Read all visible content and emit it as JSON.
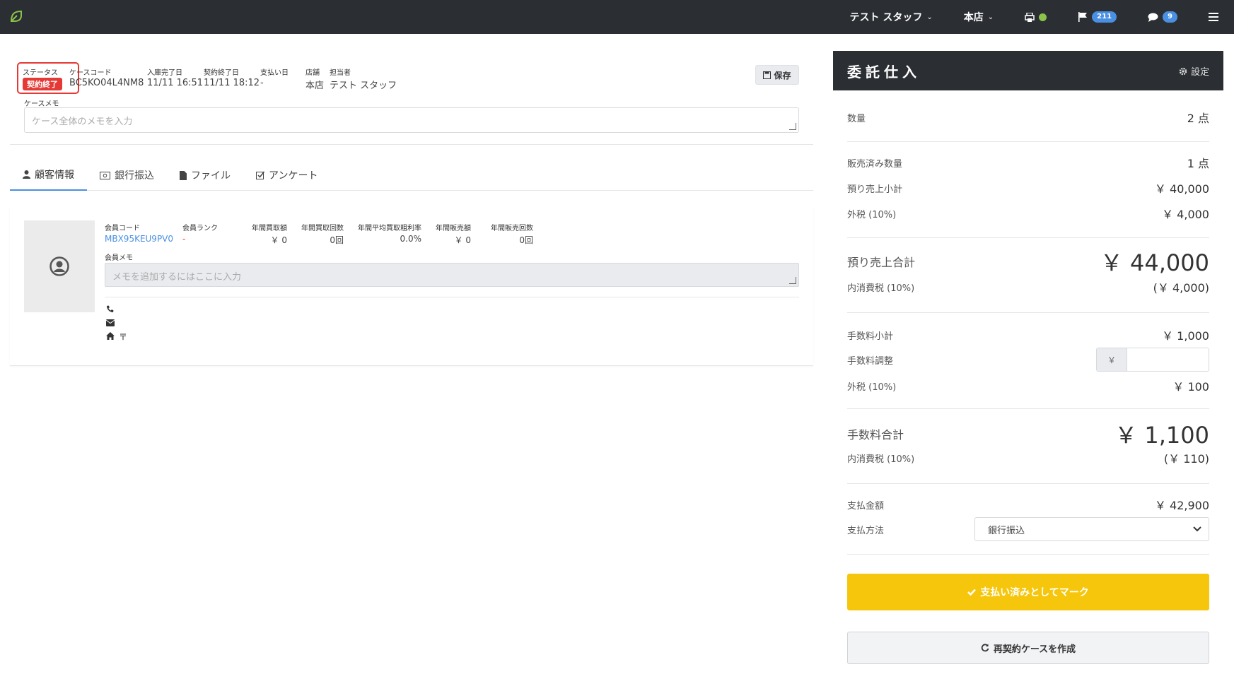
{
  "navbar": {
    "staff": "テスト スタッフ",
    "store": "本店",
    "flag_count": "211",
    "chat_count": "9"
  },
  "case": {
    "status_label": "ステータス",
    "status_value": "契約終了",
    "code_label": "ケースコード",
    "code_value": "BC5KO04L4NM8",
    "received_label": "入庫完了日",
    "received_value": "11/11 16:51",
    "contract_end_label": "契約終了日",
    "contract_end_value": "11/11 18:12",
    "payment_date_label": "支払い日",
    "payment_date_value": "-",
    "store_label": "店舗",
    "store_value": "本店",
    "staff_label": "担当者",
    "staff_value": "テスト スタッフ",
    "save_label": "保存",
    "memo_label": "ケースメモ",
    "memo_placeholder": "ケース全体のメモを入力"
  },
  "tabs": [
    {
      "label": "顧客情報",
      "icon": "user-icon"
    },
    {
      "label": "銀行振込",
      "icon": "money-icon"
    },
    {
      "label": "ファイル",
      "icon": "file-icon"
    },
    {
      "label": "アンケート",
      "icon": "check-square-icon"
    }
  ],
  "customer": {
    "member_code_label": "会員コード",
    "member_code_value": "MBX95KEU9PV0",
    "rank_label": "会員ランク",
    "rank_value": "-",
    "annual_buy_amount_label": "年間買取額",
    "annual_buy_amount_value": "￥ 0",
    "annual_buy_count_label": "年間買取回数",
    "annual_buy_count_value": "0回",
    "avg_margin_label": "年間平均買取粗利率",
    "avg_margin_value": "0.0%",
    "annual_sales_label": "年間販売額",
    "annual_sales_value": "￥ 0",
    "annual_sales_count_label": "年間販売回数",
    "annual_sales_count_value": "0回",
    "memo_label": "会員メモ",
    "memo_placeholder": "メモを追加するにはここに入力",
    "postal_mark": "〒"
  },
  "panel": {
    "title": "委託仕入",
    "settings_label": "設定",
    "qty_label": "数量",
    "qty_value": "2 点",
    "sold_qty_label": "販売済み数量",
    "sold_qty_value": "1 点",
    "deposit_sub_label": "預り売上小計",
    "deposit_sub_value": "￥ 40,000",
    "tax_ex1_label": "外税 (10%)",
    "tax_ex1_value": "￥ 4,000",
    "deposit_total_label": "預り売上合計",
    "deposit_total_value": "￥ 44,000",
    "tax_in1_label": "内消費税 (10%)",
    "tax_in1_value": "(￥ 4,000)",
    "fee_sub_label": "手数料小計",
    "fee_sub_value": "￥ 1,000",
    "fee_adj_label": "手数料調整",
    "fee_adj_prefix": "￥",
    "tax_ex2_label": "外税 (10%)",
    "tax_ex2_value": "￥ 100",
    "fee_total_label": "手数料合計",
    "fee_total_value": "￥ 1,100",
    "tax_in2_label": "内消費税 (10%)",
    "tax_in2_value": "(￥ 110)",
    "pay_amount_label": "支払金額",
    "pay_amount_value": "￥ 42,900",
    "pay_method_label": "支払方法",
    "pay_method_value": "銀行振込",
    "mark_paid_label": "支払い済みとしてマーク",
    "recontract_label": "再契約ケースを作成"
  },
  "colors": {
    "navbar": "#2b2e33",
    "status_red": "#e53935",
    "badge_blue": "#4a90e2",
    "accent_yellow": "#f6c60d",
    "link_blue": "#4a90e2"
  }
}
